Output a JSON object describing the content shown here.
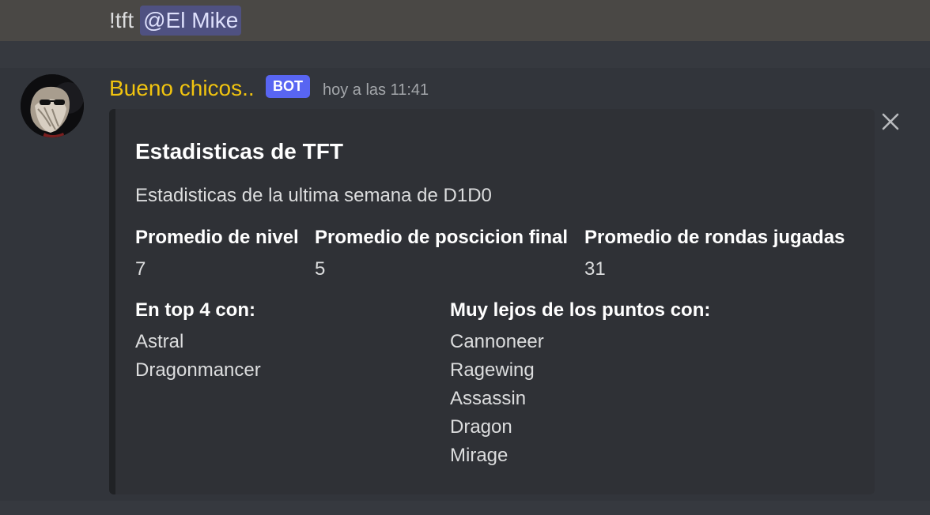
{
  "previous_message": {
    "command": "!tft",
    "mention": "@El Mike"
  },
  "message": {
    "author": "Bueno chicos..",
    "author_color": "#f1c40f",
    "bot_tag": "BOT",
    "bot_tag_color": "#5865f2",
    "timestamp": "hoy a las 11:41",
    "avatar_icon": "bearded-sunglasses-avatar"
  },
  "embed": {
    "title": "Estadisticas de TFT",
    "description": "Estadisticas de la ultima semana de D1D0",
    "close_icon": "close-icon",
    "fields": [
      {
        "name": "Promedio de nivel",
        "value": "7"
      },
      {
        "name": "Promedio de poscicion final",
        "value": "5"
      },
      {
        "name": "Promedio de rondas jugadas",
        "value": "31"
      }
    ],
    "top4": {
      "name": "En top 4 con:",
      "values": [
        "Astral",
        "Dragonmancer"
      ]
    },
    "far": {
      "name": "Muy lejos de los puntos con:",
      "values": [
        "Cannoneer",
        "Ragewing",
        "Assassin",
        "Dragon",
        "Mirage"
      ]
    }
  }
}
